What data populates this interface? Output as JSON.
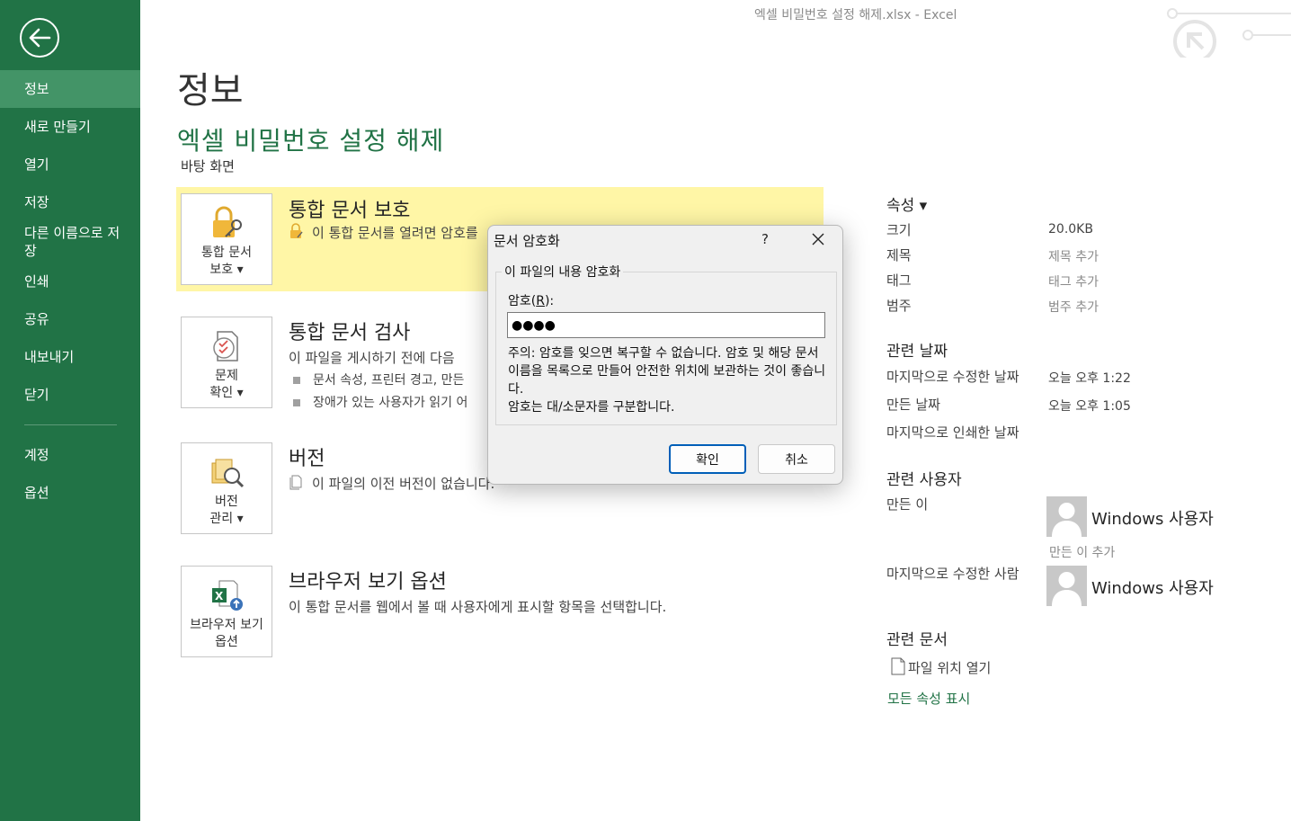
{
  "window": {
    "title": "엑셀 비밀번호 설정 해제.xlsx - Excel"
  },
  "sidebar": {
    "items": [
      {
        "label": "정보"
      },
      {
        "label": "새로 만들기"
      },
      {
        "label": "열기"
      },
      {
        "label": "저장"
      },
      {
        "label": "다른 이름으로 저장"
      },
      {
        "label": "인쇄"
      },
      {
        "label": "공유"
      },
      {
        "label": "내보내기"
      },
      {
        "label": "닫기"
      },
      {
        "label": "계정"
      },
      {
        "label": "옵션"
      }
    ]
  },
  "main": {
    "page_title": "정보",
    "doc_title": "엑셀 비밀번호 설정 해제",
    "doc_location": "바탕 화면",
    "protect": {
      "tile_label": "통합 문서\n보호 ▾",
      "heading": "통합 문서 보호",
      "desc": "이 통합 문서를 열려면 암호를"
    },
    "inspect": {
      "tile_label": "문제\n확인 ▾",
      "heading": "통합 문서 검사",
      "desc": "이 파일을 게시하기 전에 다음",
      "bullets": [
        "문서 속성, 프린터 경고, 만든",
        "장애가 있는 사용자가 읽기 어"
      ]
    },
    "versions": {
      "tile_label": "버전\n관리 ▾",
      "heading": "버전",
      "desc": "이 파일의 이전 버전이 없습니다."
    },
    "browser": {
      "tile_label": "브라우저 보기 옵션",
      "heading": "브라우저 보기 옵션",
      "desc": "이 통합 문서를 웹에서 볼 때 사용자에게 표시할 항목을 선택합니다."
    }
  },
  "properties": {
    "heading": "속성 ▾",
    "size_label": "크기",
    "size_value": "20.0KB",
    "title_label": "제목",
    "title_value": "제목 추가",
    "tags_label": "태그",
    "tags_value": "태그 추가",
    "category_label": "범주",
    "category_value": "범주 추가",
    "dates_heading": "관련 날짜",
    "modified_label": "마지막으로 수정한 날짜",
    "modified_value": "오늘 오후 1:22",
    "created_label": "만든 날짜",
    "created_value": "오늘 오후 1:05",
    "printed_label": "마지막으로 인쇄한 날짜",
    "people_heading": "관련 사용자",
    "author_label": "만든 이",
    "author_name": "Windows 사용자",
    "add_author": "만든 이 추가",
    "last_modified_by_label": "마지막으로 수정한 사람",
    "last_modified_by_name": "Windows 사용자",
    "docs_heading": "관련 문서",
    "open_location": "파일 위치 열기",
    "show_all": "모든 속성 표시"
  },
  "dialog": {
    "title": "문서 암호화",
    "help": "?",
    "group_label": "이 파일의 내용 암호화",
    "password_label_prefix": "암호(",
    "password_label_key": "R",
    "password_label_suffix": "):",
    "password_value": "●●●●",
    "notice": "주의: 암호를 잊으면 복구할 수 없습니다. 암호 및 해당 문서 이름을 목록으로 만들어 안전한 위치에 보관하는 것이 좋습니다.\n암호는 대/소문자를 구분합니다.",
    "ok_label": "확인",
    "cancel_label": "취소"
  },
  "colors": {
    "accent": "#217346",
    "sidebar_active": "#439467",
    "highlight": "#fff6a6",
    "dialog_primary_border": "#005fb8"
  }
}
